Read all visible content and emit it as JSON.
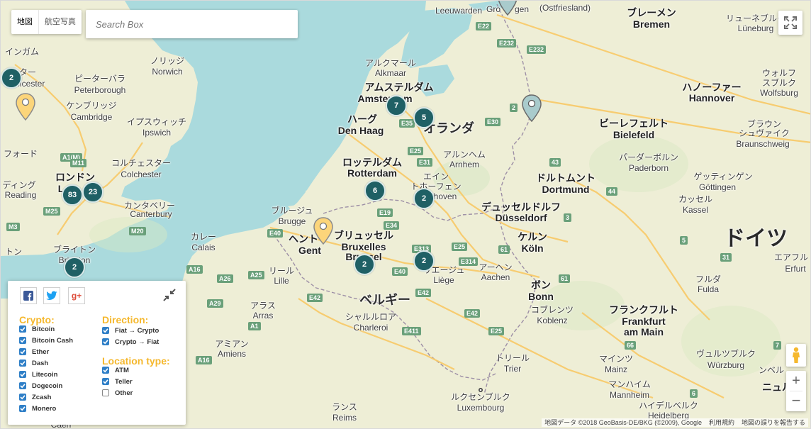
{
  "map_controls": {
    "map_type_labels": [
      "地図",
      "航空写真"
    ],
    "search_placeholder": "Search Box"
  },
  "labels": [
    {
      "t": "インガム",
      "c": "lbl"
    },
    {
      "t": "スター",
      "c": "lbl"
    },
    {
      "t": "Leicester",
      "c": "lbl"
    },
    {
      "t": "ピーターバラ",
      "c": "lbl"
    },
    {
      "t": "Peterborough",
      "c": "lbl"
    },
    {
      "t": "ノリッジ",
      "c": "lbl"
    },
    {
      "t": "Norwich",
      "c": "lbl"
    },
    {
      "t": "ケンブリッジ",
      "c": "lbl"
    },
    {
      "t": "Cambridge",
      "c": "lbl"
    },
    {
      "t": "イプスウィッチ",
      "c": "lbl"
    },
    {
      "t": "Ipswich",
      "c": "lbl"
    },
    {
      "t": "フォード",
      "c": "lbl"
    },
    {
      "t": "コルチェスター",
      "c": "lbl"
    },
    {
      "t": "Colchester",
      "c": "lbl"
    },
    {
      "t": "ロンドン",
      "c": "lbl big"
    },
    {
      "t": "L",
      "c": "lbl big"
    },
    {
      "t": "ディング",
      "c": "lbl"
    },
    {
      "t": "Reading",
      "c": "lbl"
    },
    {
      "t": "カンタベリー",
      "c": "lbl"
    },
    {
      "t": "Canterbury",
      "c": "lbl"
    },
    {
      "t": "ブライトン",
      "c": "lbl"
    },
    {
      "t": "Brighton",
      "c": "lbl"
    },
    {
      "t": "トン",
      "c": "lbl"
    },
    {
      "t": "Leeuwarden",
      "c": "lbl"
    },
    {
      "t": "Gro",
      "c": "lbl"
    },
    {
      "t": "gen",
      "c": "lbl"
    },
    {
      "t": "(Ostfriesland)",
      "c": "lbl"
    },
    {
      "t": "ブレーメン",
      "c": "lbl big"
    },
    {
      "t": "Bremen",
      "c": "lbl big"
    },
    {
      "t": "リューネブルク",
      "c": "lbl"
    },
    {
      "t": "Lüneburg",
      "c": "lbl"
    },
    {
      "t": "アルクマール",
      "c": "lbl"
    },
    {
      "t": "Alkmaar",
      "c": "lbl"
    },
    {
      "t": "アムステルダム",
      "c": "lbl big"
    },
    {
      "t": "Amsterdam",
      "c": "lbl big"
    },
    {
      "t": "ハーグ",
      "c": "lbl big"
    },
    {
      "t": "Den Haag",
      "c": "lbl big"
    },
    {
      "t": "オランダ",
      "c": "lbl country"
    },
    {
      "t": "ハノーファー",
      "c": "lbl big"
    },
    {
      "t": "Hannover",
      "c": "lbl big"
    },
    {
      "t": "ウォルフ",
      "c": "lbl"
    },
    {
      "t": "スブルク",
      "c": "lbl"
    },
    {
      "t": "Wolfsburg",
      "c": "lbl"
    },
    {
      "t": "ビーレフェルト",
      "c": "lbl big"
    },
    {
      "t": "Bielefeld",
      "c": "lbl big"
    },
    {
      "t": "ブラウン",
      "c": "lbl"
    },
    {
      "t": "シュヴァイク",
      "c": "lbl"
    },
    {
      "t": "Braunschweig",
      "c": "lbl"
    },
    {
      "t": "アルンヘム",
      "c": "lbl"
    },
    {
      "t": "Arnhem",
      "c": "lbl"
    },
    {
      "t": "ロッテルダム",
      "c": "lbl big"
    },
    {
      "t": "Rotterdam",
      "c": "lbl big"
    },
    {
      "t": "パーダーボルン",
      "c": "lbl"
    },
    {
      "t": "Paderborn",
      "c": "lbl"
    },
    {
      "t": "エイン",
      "c": "lbl"
    },
    {
      "t": "トホーフェン",
      "c": "lbl"
    },
    {
      "t": "hoven",
      "c": "lbl"
    },
    {
      "t": "ドルトムント",
      "c": "lbl big"
    },
    {
      "t": "Dortmund",
      "c": "lbl big"
    },
    {
      "t": "ゲッティンゲン",
      "c": "lbl"
    },
    {
      "t": "Göttingen",
      "c": "lbl"
    },
    {
      "t": "カッセル",
      "c": "lbl"
    },
    {
      "t": "Kassel",
      "c": "lbl"
    },
    {
      "t": "ブルージュ",
      "c": "lbl"
    },
    {
      "t": "Brugge",
      "c": "lbl"
    },
    {
      "t": "デュッセルドルフ",
      "c": "lbl big"
    },
    {
      "t": "Düsseldorf",
      "c": "lbl big"
    },
    {
      "t": "ヘント",
      "c": "lbl big"
    },
    {
      "t": "Gent",
      "c": "lbl big"
    },
    {
      "t": "ブリュッセル",
      "c": "lbl big"
    },
    {
      "t": "Bruxelles",
      "c": "lbl big"
    },
    {
      "t": "Brussel",
      "c": "lbl big"
    },
    {
      "t": "カレー",
      "c": "lbl"
    },
    {
      "t": "Calais",
      "c": "lbl"
    },
    {
      "t": "ケルン",
      "c": "lbl big"
    },
    {
      "t": "Köln",
      "c": "lbl big"
    },
    {
      "t": "ドイツ",
      "c": "lbl huge"
    },
    {
      "t": "エアフル",
      "c": "lbl"
    },
    {
      "t": "Erfurt",
      "c": "lbl"
    },
    {
      "t": "リール",
      "c": "lbl"
    },
    {
      "t": "Lille",
      "c": "lbl"
    },
    {
      "t": "リエージュ",
      "c": "lbl"
    },
    {
      "t": "Liège",
      "c": "lbl"
    },
    {
      "t": "アーヘン",
      "c": "lbl"
    },
    {
      "t": "Aachen",
      "c": "lbl"
    },
    {
      "t": "ボン",
      "c": "lbl big"
    },
    {
      "t": "Bonn",
      "c": "lbl big"
    },
    {
      "t": "フルダ",
      "c": "lbl"
    },
    {
      "t": "Fulda",
      "c": "lbl"
    },
    {
      "t": "アラス",
      "c": "lbl"
    },
    {
      "t": "Arras",
      "c": "lbl"
    },
    {
      "t": "ベルギー",
      "c": "lbl country"
    },
    {
      "t": "シャルルロア",
      "c": "lbl"
    },
    {
      "t": "Charleroi",
      "c": "lbl"
    },
    {
      "t": "コブレンツ",
      "c": "lbl"
    },
    {
      "t": "Koblenz",
      "c": "lbl"
    },
    {
      "t": "フランクフルト",
      "c": "lbl big"
    },
    {
      "t": "Frankfurt",
      "c": "lbl big"
    },
    {
      "t": "am Main",
      "c": "lbl big"
    },
    {
      "t": "アミアン",
      "c": "lbl"
    },
    {
      "t": "Amiens",
      "c": "lbl"
    },
    {
      "t": "ヴュルツブルク",
      "c": "lbl"
    },
    {
      "t": "Würzburg",
      "c": "lbl"
    },
    {
      "t": "トリール",
      "c": "lbl"
    },
    {
      "t": "Trier",
      "c": "lbl"
    },
    {
      "t": "マインツ",
      "c": "lbl"
    },
    {
      "t": "Mainz",
      "c": "lbl"
    },
    {
      "t": "マンハイム",
      "c": "lbl"
    },
    {
      "t": "Mannheim",
      "c": "lbl"
    },
    {
      "t": "ルクセンブルク",
      "c": "lbl"
    },
    {
      "t": "Luxembourg",
      "c": "lbl"
    },
    {
      "t": "ハイデルベルク",
      "c": "lbl"
    },
    {
      "t": "Heidelberg",
      "c": "lbl"
    },
    {
      "t": "ランス",
      "c": "lbl"
    },
    {
      "t": "Reims",
      "c": "lbl"
    },
    {
      "t": "ニュル",
      "c": "lbl big"
    },
    {
      "t": "ンベル",
      "c": "lbl"
    },
    {
      "t": "Caen",
      "c": "lbl"
    }
  ],
  "roads": [
    {
      "t": "E22",
      "c": "road"
    },
    {
      "t": "E232",
      "c": "road"
    },
    {
      "t": "E232",
      "c": "road"
    },
    {
      "t": "E35",
      "c": "road"
    },
    {
      "t": "E30",
      "c": "road"
    },
    {
      "t": "E25",
      "c": "road"
    },
    {
      "t": "E31",
      "c": "road"
    },
    {
      "t": "E19",
      "c": "road"
    },
    {
      "t": "E34",
      "c": "road"
    },
    {
      "t": "E40",
      "c": "road"
    },
    {
      "t": "E313",
      "c": "road"
    },
    {
      "t": "E25",
      "c": "road"
    },
    {
      "t": "E314",
      "c": "road"
    },
    {
      "t": "E40",
      "c": "road"
    },
    {
      "t": "E42",
      "c": "road"
    },
    {
      "t": "E42",
      "c": "road"
    },
    {
      "t": "E42",
      "c": "road"
    },
    {
      "t": "E411",
      "c": "road"
    },
    {
      "t": "E25",
      "c": "road"
    },
    {
      "t": "A16",
      "c": "road"
    },
    {
      "t": "A26",
      "c": "road"
    },
    {
      "t": "A25",
      "c": "road"
    },
    {
      "t": "A1",
      "c": "road"
    },
    {
      "t": "A29",
      "c": "road"
    },
    {
      "t": "A16",
      "c": "road"
    },
    {
      "t": "A1(M)",
      "c": "road"
    },
    {
      "t": "M11",
      "c": "road"
    },
    {
      "t": "M25",
      "c": "road"
    },
    {
      "t": "M20",
      "c": "road"
    },
    {
      "t": "M3",
      "c": "road"
    },
    {
      "t": "61",
      "c": "road"
    },
    {
      "t": "61",
      "c": "road"
    },
    {
      "t": "43",
      "c": "road"
    },
    {
      "t": "44",
      "c": "road"
    },
    {
      "t": "2",
      "c": "road"
    },
    {
      "t": "3",
      "c": "road"
    },
    {
      "t": "5",
      "c": "road"
    },
    {
      "t": "66",
      "c": "road"
    },
    {
      "t": "6",
      "c": "road"
    },
    {
      "t": "7",
      "c": "road"
    },
    {
      "t": "31",
      "c": "road"
    }
  ],
  "clusters": [
    {
      "count": "2"
    },
    {
      "count": "7"
    },
    {
      "count": "5"
    },
    {
      "count": "83"
    },
    {
      "count": "23"
    },
    {
      "count": "6"
    },
    {
      "count": "2"
    },
    {
      "count": "2"
    },
    {
      "count": "2"
    },
    {
      "count": "2"
    }
  ],
  "filter_panel": {
    "social": [
      {
        "label": "f",
        "color": "#3b5998"
      },
      {
        "label": "t",
        "color": "#1da1f2"
      },
      {
        "label": "g+",
        "color": "#dd4b39"
      }
    ],
    "crypto_title": "Crypto:",
    "crypto_options": [
      {
        "label": "Bitcoin",
        "checked": true
      },
      {
        "label": "Bitcoin Cash",
        "checked": true
      },
      {
        "label": "Ether",
        "checked": true
      },
      {
        "label": "Dash",
        "checked": true
      },
      {
        "label": "Litecoin",
        "checked": true
      },
      {
        "label": "Dogecoin",
        "checked": true
      },
      {
        "label": "Zcash",
        "checked": true
      },
      {
        "label": "Monero",
        "checked": true
      }
    ],
    "direction_title": "Direction:",
    "direction_options": [
      {
        "label": "Fiat → Crypto",
        "checked": true
      },
      {
        "label": "Crypto → Fiat",
        "checked": true
      }
    ],
    "location_title": "Location type:",
    "location_options": [
      {
        "label": "ATM",
        "checked": true
      },
      {
        "label": "Teller",
        "checked": true
      },
      {
        "label": "Other",
        "checked": false
      }
    ]
  },
  "attribution": [
    "地図データ ©2018 GeoBasis-DE/BKG (©2009), Google",
    "利用規約",
    "地図の誤りを報告する"
  ],
  "colors": {
    "water": "#aadadd",
    "land": "#eeeed6",
    "cluster": "#1f6065",
    "pin_yellow": "#fcd57a",
    "pin_gray": "#a9cbcc",
    "accent": "#f5b82e",
    "checkbox": "#2f7fc7"
  }
}
